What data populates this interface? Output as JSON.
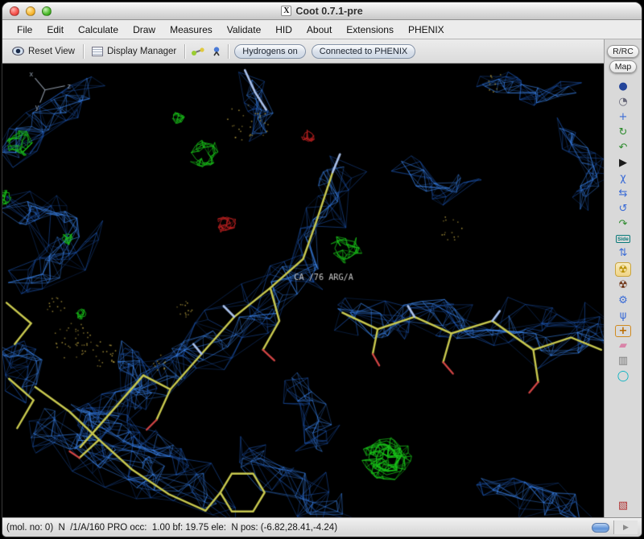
{
  "window": {
    "title": "Coot 0.7.1-pre",
    "x_icon": "X"
  },
  "menu_bar": {
    "items": [
      {
        "label": "File"
      },
      {
        "label": "Edit"
      },
      {
        "label": "Calculate"
      },
      {
        "label": "Draw"
      },
      {
        "label": "Measures"
      },
      {
        "label": "Validate"
      },
      {
        "label": "HID"
      },
      {
        "label": "About"
      },
      {
        "label": "Extensions"
      },
      {
        "label": "PHENIX"
      }
    ]
  },
  "toolbar": {
    "reset_view_label": "Reset View",
    "display_manager_label": "Display Manager",
    "hydrogens_button": "Hydrogens on",
    "phenix_button": "Connected to PHENIX"
  },
  "side_panel": {
    "rrc_button": "R/RC",
    "map_button": "Map",
    "icons": [
      {
        "name": "map-sphere-icon",
        "glyph": "●",
        "color": "#24459a"
      },
      {
        "name": "recenter-view-icon",
        "glyph": "◔",
        "color": "#666677"
      },
      {
        "name": "move-fragment-icon",
        "glyph": "+",
        "color": "#3a6bd6"
      },
      {
        "name": "rotate-translate-zone-icon",
        "glyph": "↻",
        "color": "#2e8b2e"
      },
      {
        "name": "auto-fit-rotamer-icon",
        "glyph": "↶",
        "color": "#2e8b2e"
      },
      {
        "name": "add-terminal-residue-icon",
        "glyph": "▶",
        "color": "#1a1a1a"
      },
      {
        "name": "edit-chi-angles-icon",
        "glyph": "χ",
        "color": "#3a6bd6"
      },
      {
        "name": "cis-trans-toggle-icon",
        "glyph": "⇆",
        "color": "#3a6bd6"
      },
      {
        "name": "rotate-peptide-icon",
        "glyph": "↺",
        "color": "#3a6bd6"
      },
      {
        "name": "flip-peptide-icon",
        "glyph": "↷",
        "color": "#2e8b2e"
      },
      {
        "name": "side-chain-180-icon",
        "glyph": "Side",
        "color": "#0a7a7a"
      },
      {
        "name": "jiggle-fit-icon",
        "glyph": "⇅",
        "color": "#3a6bd6"
      },
      {
        "name": "real-space-refine-icon",
        "glyph": "☢",
        "color": "#b98f00",
        "selected": true
      },
      {
        "name": "regularize-zone-icon",
        "glyph": "☢",
        "color": "#6b2f10"
      },
      {
        "name": "sphere-refine-icon",
        "glyph": "⚙",
        "color": "#3a6bd6"
      },
      {
        "name": "torsion-general-icon",
        "glyph": "ψ",
        "color": "#3a6bd6"
      },
      {
        "name": "add-atom-icon",
        "glyph": "+",
        "color": "#b86a00",
        "boxed": true
      },
      {
        "name": "eraser-icon",
        "glyph": "▰",
        "color": "#d984a8"
      },
      {
        "name": "delete-item-icon",
        "glyph": "▥",
        "color": "#7a7a7a"
      },
      {
        "name": "go-to-blob-icon",
        "glyph": "◯",
        "color": "#00b0c0"
      },
      {
        "name": "display-issues-icon",
        "glyph": "▧",
        "color": "#b03030"
      }
    ]
  },
  "viewport": {
    "atom_label": "CA /76 ARG/A",
    "axes": {
      "x": "x",
      "y": "y",
      "z": "z"
    },
    "colors": {
      "background": "#000000",
      "mesh_bright": "#3c87f0",
      "mesh_dim": "#1d55b0",
      "sticks": "#c9c94f",
      "nitrogen": "#a9c0ea",
      "oxygen": "#d24545",
      "positive_density": "#19c019",
      "negative_density": "#c32222",
      "waters": "#a8923a",
      "label": "#c9c9c9",
      "axes": "#8f9aa8"
    }
  },
  "status_bar": {
    "text": "(mol. no: 0)  N  /1/A/160 PRO occ:  1.00 bf: 19.75 ele:  N pos: (-6.82,28.41,-4.24)",
    "expander_glyph": "▶"
  }
}
